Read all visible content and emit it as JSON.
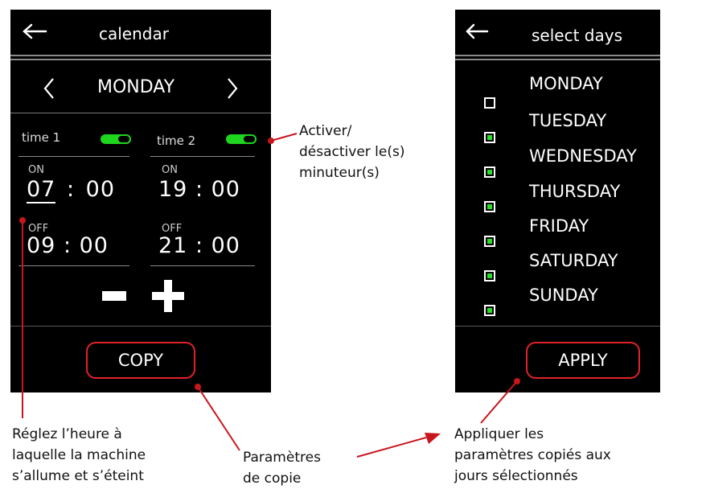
{
  "left_screen": {
    "title": "calendar",
    "day": "MONDAY",
    "timers": [
      {
        "label": "time 1",
        "enabled": true,
        "on_label": "ON",
        "on_hour": "07",
        "on_min": "00",
        "off_label": "OFF",
        "off_time": "09 : 00"
      },
      {
        "label": "time 2",
        "enabled": true,
        "on_label": "ON",
        "on_time": "19 : 00",
        "off_label": "OFF",
        "off_time": "21 : 00"
      }
    ],
    "colon": ":",
    "minus": "–",
    "plus": "+",
    "copy_label": "COPY"
  },
  "right_screen": {
    "title": "select days",
    "days": [
      {
        "label": "MONDAY",
        "checked": false
      },
      {
        "label": "TUESDAY",
        "checked": true
      },
      {
        "label": "WEDNESDAY",
        "checked": true
      },
      {
        "label": "THURSDAY",
        "checked": true
      },
      {
        "label": "FRIDAY",
        "checked": true
      },
      {
        "label": "SATURDAY",
        "checked": true
      },
      {
        "label": "SUNDAY",
        "checked": true
      }
    ],
    "apply_label": "APPLY"
  },
  "annotations": {
    "toggle_note_line1": "Activer/",
    "toggle_note_line2": "désactiver le(s)",
    "toggle_note_line3": "minuteur(s)",
    "time_note_line1": "Réglez l’heure à",
    "time_note_line2": "laquelle la machine",
    "time_note_line3": "s’allume et s’éteint",
    "copy_note_line1": "Paramètres",
    "copy_note_line2": "de copie",
    "apply_note_line1": "Appliquer les",
    "apply_note_line2": "paramètres copiés aux",
    "apply_note_line3": "jours sélectionnés"
  },
  "colors": {
    "accent_red": "#c8161d",
    "toggle_green": "#1fd61f",
    "check_green": "#26e026"
  }
}
